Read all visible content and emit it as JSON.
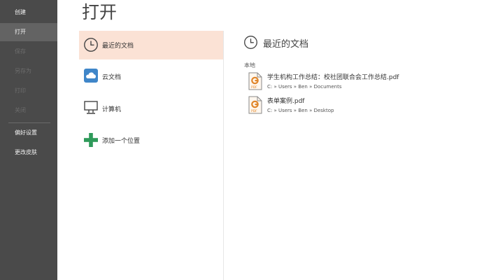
{
  "sidebar": {
    "items": [
      {
        "label": "创建",
        "state": "normal"
      },
      {
        "label": "打开",
        "state": "active"
      },
      {
        "label": "保存",
        "state": "disabled"
      },
      {
        "label": "另存为",
        "state": "disabled"
      },
      {
        "label": "打印",
        "state": "disabled"
      },
      {
        "label": "关闭",
        "state": "disabled"
      },
      {
        "label": "偏好设置",
        "state": "normal"
      },
      {
        "label": "更改皮肤",
        "state": "normal"
      }
    ]
  },
  "page": {
    "title": "打开"
  },
  "places": [
    {
      "label": "最近的文档",
      "icon": "clock-icon",
      "active": true
    },
    {
      "label": "云文档",
      "icon": "cloud-icon",
      "active": false
    },
    {
      "label": "计算机",
      "icon": "computer-icon",
      "active": false
    },
    {
      "label": "添加一个位置",
      "icon": "plus-icon",
      "active": false
    }
  ],
  "recent": {
    "title": "最近的文档",
    "group_label": "本地",
    "files": [
      {
        "name": "学生机构工作总结：校社团联合会工作总结.pdf",
        "path": "C: » Users » Ben » Documents",
        "icon": "pdf-file-icon"
      },
      {
        "name": "表单案例.pdf",
        "path": "C: » Users » Ben » Desktop",
        "icon": "pdf-file-icon"
      }
    ]
  },
  "colors": {
    "sidebar_bg": "#4a4a4a",
    "sidebar_active": "#636363",
    "place_active_bg": "#fbe2d5",
    "pdf_accent": "#e0862a",
    "plus_green": "#2e9a5a",
    "cloud_blue": "#3f86c9"
  }
}
